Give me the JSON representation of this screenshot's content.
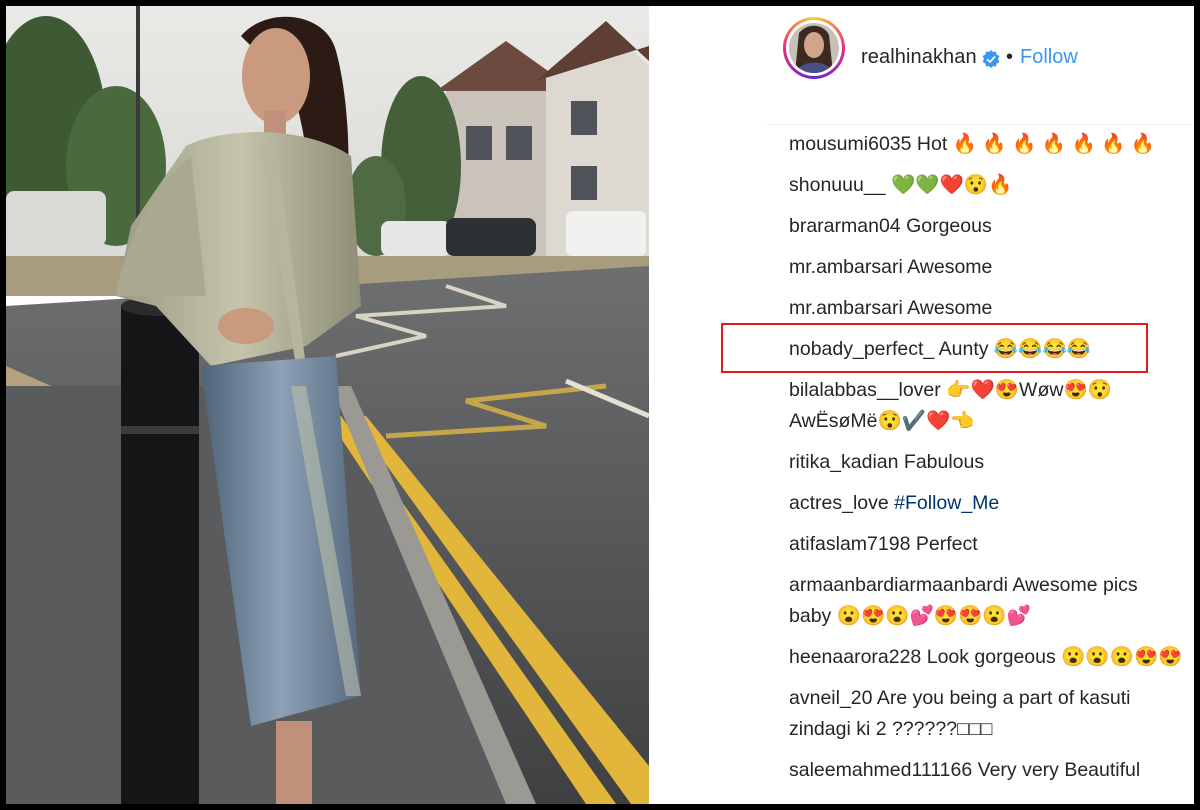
{
  "post": {
    "username": "realhinakhan",
    "follow_label": "Follow",
    "separator": "•",
    "verified_icon": "verified-badge-icon",
    "accent_color": "#3897f0",
    "highlight_color": "#e0191b"
  },
  "comments": [
    {
      "user": "mousumi6035",
      "text": "Hot 🔥 🔥 🔥 🔥 🔥 🔥 🔥"
    },
    {
      "user": "shonuuu__",
      "text": "💚💚❤️😯🔥"
    },
    {
      "user": "brararman04",
      "text": "Gorgeous"
    },
    {
      "user": "mr.ambarsari",
      "text": "Awesome"
    },
    {
      "user": "mr.ambarsari",
      "text": "Awesome"
    },
    {
      "user": "nobady_perfect_",
      "text": "Aunty 😂😂😂😂"
    },
    {
      "user": "bilalabbas__lover",
      "text": "👉❤️😍Wøw😍😯 AwËsøMë😯✔️❤️👈"
    },
    {
      "user": "ritika_kadian",
      "text": "Fabulous"
    },
    {
      "user": "actres_love",
      "text": "",
      "hashtag": "#Follow_Me"
    },
    {
      "user": "atifaslam7198",
      "text": "Perfect"
    },
    {
      "user": "armaanbardiarmaanbardi",
      "text": "Awesome pics baby 😮😍😮💕😍😍😮💕"
    },
    {
      "user": "heenaarora228",
      "text": "Look gorgeous 😮😮😮😍😍"
    },
    {
      "user": "avneil_20",
      "text": "Are you being a part of kasuti zindagi ki 2 ??????□□□"
    },
    {
      "user": "saleemahmed111166",
      "text": "Very very Beautiful"
    }
  ]
}
